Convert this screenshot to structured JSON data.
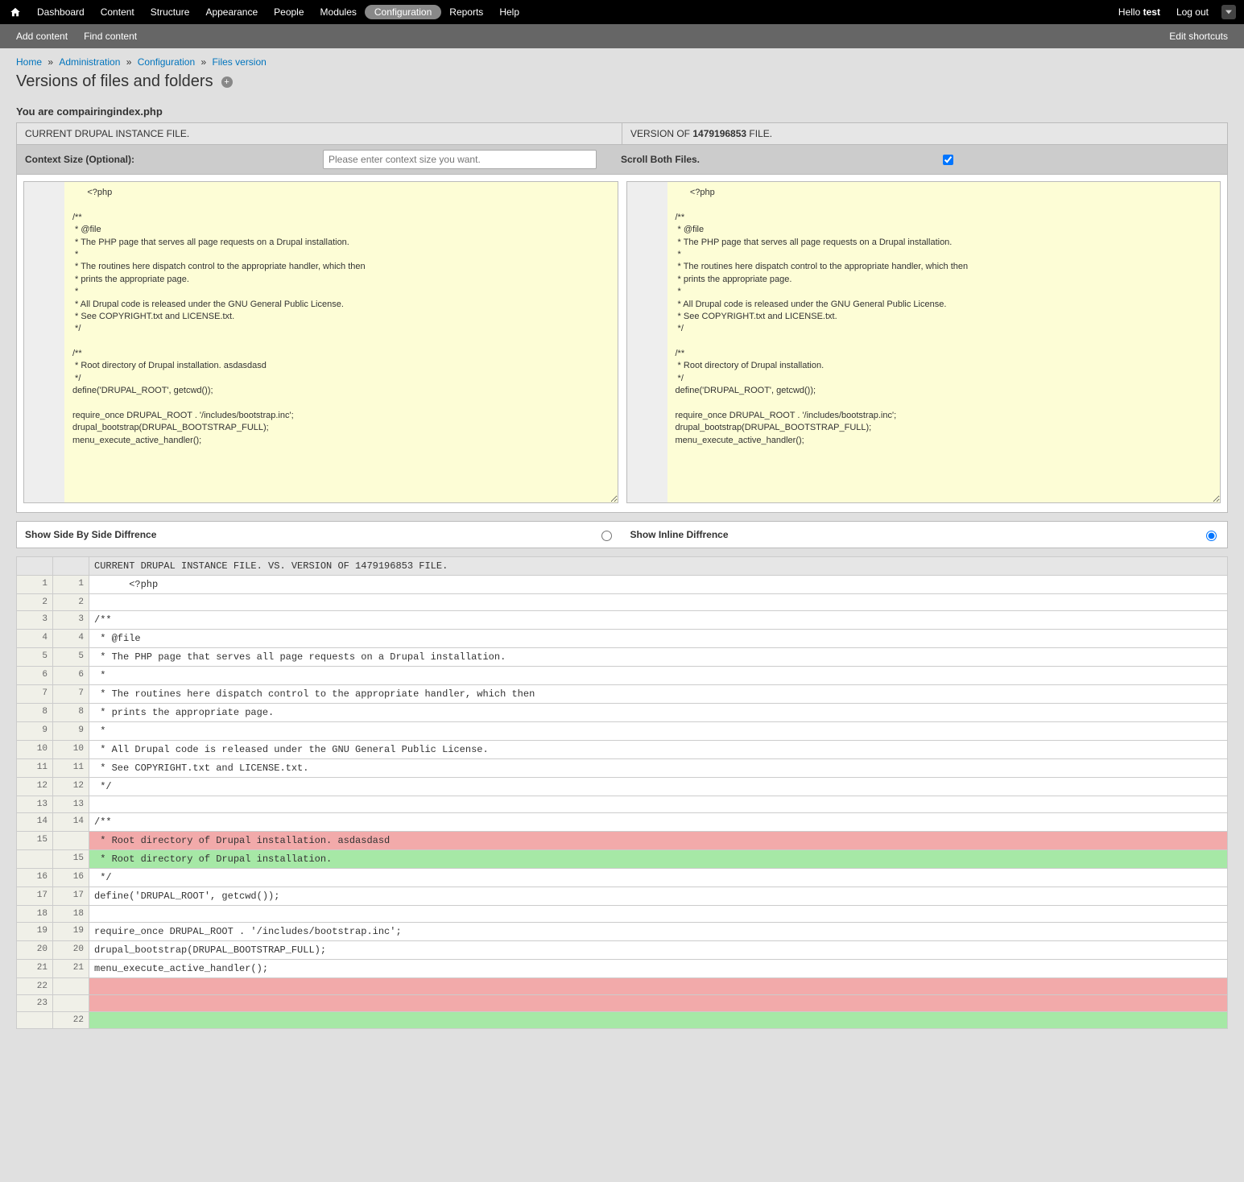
{
  "topbar": {
    "menu": [
      "Dashboard",
      "Content",
      "Structure",
      "Appearance",
      "People",
      "Modules",
      "Configuration",
      "Reports",
      "Help"
    ],
    "active_index": 6,
    "hello_prefix": "Hello ",
    "user": "test",
    "logout": "Log out"
  },
  "shortcutbar": {
    "items": [
      "Add content",
      "Find content"
    ],
    "edit": "Edit shortcuts"
  },
  "breadcrumb": {
    "items": [
      "Home",
      "Administration",
      "Configuration",
      "Files version"
    ],
    "sep": "»"
  },
  "page_title": "Versions of files and folders",
  "compairing_line": "You are compairingindex.php",
  "panel_headers": {
    "left": "CURRENT DRUPAL INSTANCE FILE.",
    "right_prefix": "VERSION OF ",
    "right_version": "1479196853",
    "right_suffix": " FILE."
  },
  "context": {
    "label": "Context Size (Optional):",
    "placeholder": "Please enter context size you want.",
    "scroll_label": "Scroll Both Files.",
    "scroll_checked": true
  },
  "file_left": "      <?php\n\n/**\n * @file\n * The PHP page that serves all page requests on a Drupal installation.\n *\n * The routines here dispatch control to the appropriate handler, which then\n * prints the appropriate page.\n *\n * All Drupal code is released under the GNU General Public License.\n * See COPYRIGHT.txt and LICENSE.txt.\n */\n\n/**\n * Root directory of Drupal installation. asdasdasd\n */\ndefine('DRUPAL_ROOT', getcwd());\n\nrequire_once DRUPAL_ROOT . '/includes/bootstrap.inc';\ndrupal_bootstrap(DRUPAL_BOOTSTRAP_FULL);\nmenu_execute_active_handler();\n",
  "file_right": "      <?php\n\n/**\n * @file\n * The PHP page that serves all page requests on a Drupal installation.\n *\n * The routines here dispatch control to the appropriate handler, which then\n * prints the appropriate page.\n *\n * All Drupal code is released under the GNU General Public License.\n * See COPYRIGHT.txt and LICENSE.txt.\n */\n\n/**\n * Root directory of Drupal installation.\n */\ndefine('DRUPAL_ROOT', getcwd());\n\nrequire_once DRUPAL_ROOT . '/includes/bootstrap.inc';\ndrupal_bootstrap(DRUPAL_BOOTSTRAP_FULL);\nmenu_execute_active_handler();\n",
  "view_toggle": {
    "side_label": "Show Side By Side Diffrence",
    "inline_label": "Show Inline Diffrence",
    "selected": "inline"
  },
  "diff_header": "CURRENT DRUPAL INSTANCE FILE. VS. VERSION OF 1479196853 FILE.",
  "diff_rows": [
    {
      "l": "1",
      "r": "1",
      "t": "      <?php",
      "k": ""
    },
    {
      "l": "2",
      "r": "2",
      "t": "",
      "k": ""
    },
    {
      "l": "3",
      "r": "3",
      "t": "/**",
      "k": ""
    },
    {
      "l": "4",
      "r": "4",
      "t": " * @file",
      "k": ""
    },
    {
      "l": "5",
      "r": "5",
      "t": " * The PHP page that serves all page requests on a Drupal installation.",
      "k": ""
    },
    {
      "l": "6",
      "r": "6",
      "t": " *",
      "k": ""
    },
    {
      "l": "7",
      "r": "7",
      "t": " * The routines here dispatch control to the appropriate handler, which then",
      "k": ""
    },
    {
      "l": "8",
      "r": "8",
      "t": " * prints the appropriate page.",
      "k": ""
    },
    {
      "l": "9",
      "r": "9",
      "t": " *",
      "k": ""
    },
    {
      "l": "10",
      "r": "10",
      "t": " * All Drupal code is released under the GNU General Public License.",
      "k": ""
    },
    {
      "l": "11",
      "r": "11",
      "t": " * See COPYRIGHT.txt and LICENSE.txt.",
      "k": ""
    },
    {
      "l": "12",
      "r": "12",
      "t": " */",
      "k": ""
    },
    {
      "l": "13",
      "r": "13",
      "t": "",
      "k": ""
    },
    {
      "l": "14",
      "r": "14",
      "t": "/**",
      "k": ""
    },
    {
      "l": "15",
      "r": "",
      "t": " * Root directory of Drupal installation. asdasdasd",
      "k": "del"
    },
    {
      "l": "",
      "r": "15",
      "t": " * Root directory of Drupal installation.",
      "k": "ins"
    },
    {
      "l": "16",
      "r": "16",
      "t": " */",
      "k": ""
    },
    {
      "l": "17",
      "r": "17",
      "t": "define('DRUPAL_ROOT', getcwd());",
      "k": ""
    },
    {
      "l": "18",
      "r": "18",
      "t": "",
      "k": ""
    },
    {
      "l": "19",
      "r": "19",
      "t": "require_once DRUPAL_ROOT . '/includes/bootstrap.inc';",
      "k": ""
    },
    {
      "l": "20",
      "r": "20",
      "t": "drupal_bootstrap(DRUPAL_BOOTSTRAP_FULL);",
      "k": ""
    },
    {
      "l": "21",
      "r": "21",
      "t": "menu_execute_active_handler();",
      "k": ""
    },
    {
      "l": "22",
      "r": "",
      "t": "",
      "k": "del"
    },
    {
      "l": "23",
      "r": "",
      "t": "",
      "k": "del"
    },
    {
      "l": "",
      "r": "22",
      "t": "",
      "k": "ins"
    }
  ]
}
